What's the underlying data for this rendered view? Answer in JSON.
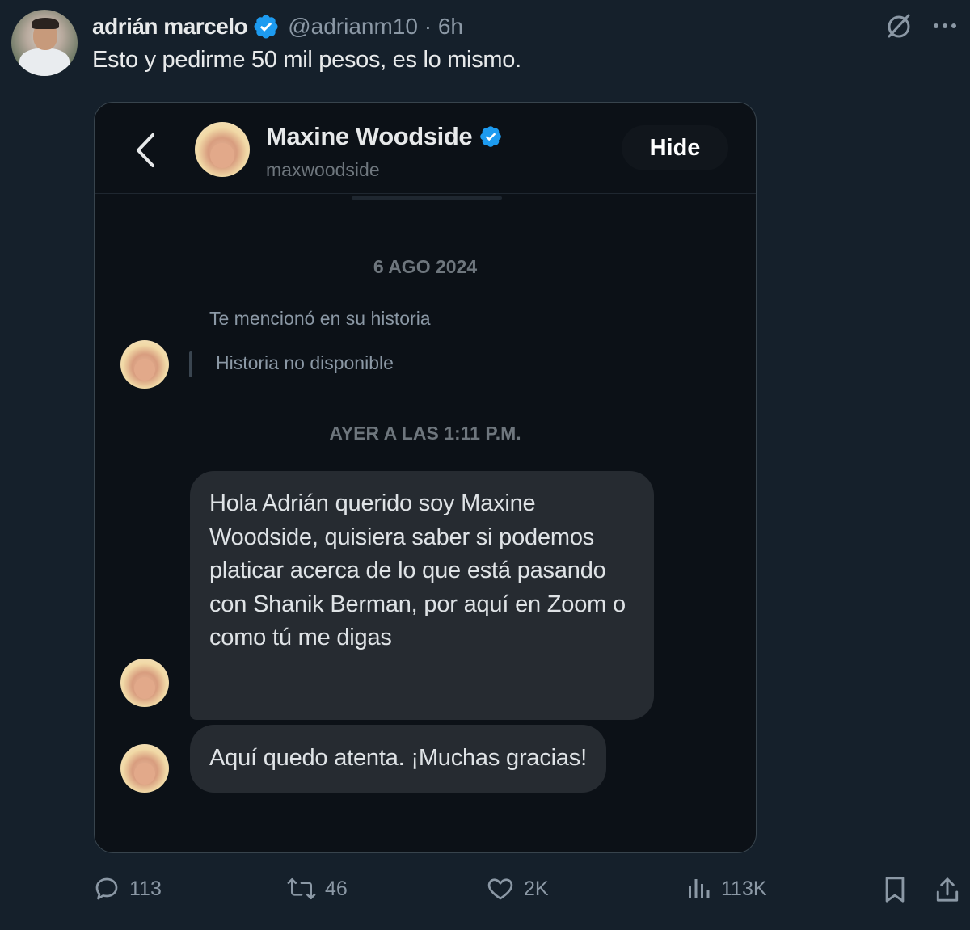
{
  "tweet": {
    "author_name": "adrián marcelo",
    "handle": "@adrianm10",
    "time": " · 6h",
    "text": "Esto y pedirme 50 mil pesos, es lo mismo."
  },
  "dm": {
    "contact_name": "Maxine Woodside",
    "contact_handle": "maxwoodside",
    "hide_label": "Hide",
    "date_1": "6 AGO 2024",
    "mention_text": "Te mencionó en su historia",
    "story_text": "Historia no disponible",
    "date_2": "AYER A LAS 1:11 P.M.",
    "messages": [
      "Hola Adrián querido soy Maxine Woodside, quisiera saber si podemos platicar acerca de lo que está pasando con Shanik Berman, por aquí en Zoom o como tú me digas",
      "Aquí quedo atenta. ¡Muchas gracias!"
    ]
  },
  "actions": {
    "replies": "113",
    "reposts": "46",
    "likes": "2K",
    "views": "113K"
  },
  "icons": {
    "top_right": [
      "grok-icon",
      "more-icon"
    ],
    "action_bar": [
      "reply-icon",
      "retweet-icon",
      "heart-icon",
      "views-icon",
      "bookmark-icon",
      "share-icon"
    ]
  },
  "colors": {
    "background": "#15202b",
    "card_background": "#0c1117",
    "verified": "#1d9bf0",
    "text_primary": "#e7e9ea",
    "text_secondary": "#8b98a5",
    "bubble": "#262b31"
  }
}
